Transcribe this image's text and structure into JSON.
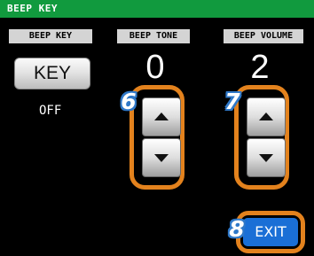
{
  "window": {
    "title": "BEEP KEY"
  },
  "columns": [
    {
      "header": "BEEP KEY"
    },
    {
      "header": "BEEP TONE"
    },
    {
      "header": "BEEP VOLUME"
    }
  ],
  "beep_key": {
    "button_label": "KEY",
    "state": "OFF"
  },
  "beep_tone": {
    "value": "0"
  },
  "beep_volume": {
    "value": "2"
  },
  "callouts": {
    "tone": "6",
    "volume": "7",
    "exit": "8"
  },
  "exit": {
    "label": "EXIT"
  },
  "icons": {
    "increase": "triangle-up-icon",
    "decrease": "triangle-down-icon"
  },
  "colors": {
    "title_bar": "#119a3e",
    "header_bg": "#d4d4d4",
    "highlight": "#e3821d",
    "callout": "#2f78c8",
    "exit_button": "#1a6fd6"
  }
}
